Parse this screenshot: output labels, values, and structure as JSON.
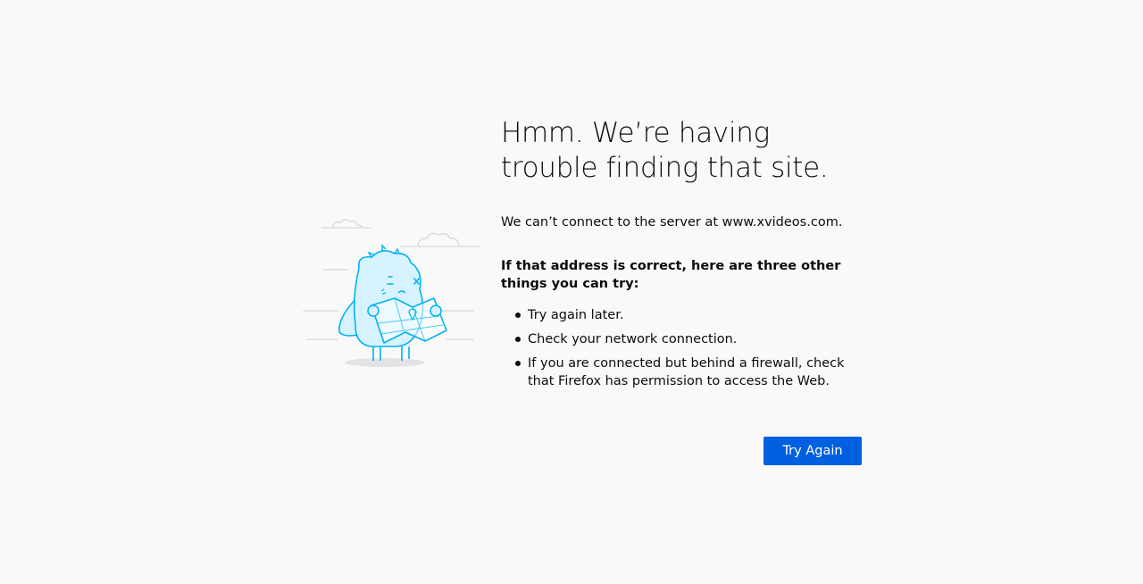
{
  "error_page": {
    "title": "Hmm. We’re having trouble finding that site.",
    "description": "We can’t connect to the server at www.xvideos.com.",
    "advice_heading": "If that address is correct, here are three other things you can try:",
    "tips": [
      "Try again later.",
      "Check your network connection.",
      "If you are connected but behind a firewall, check that Firefox has permission to access the Web."
    ],
    "try_again_label": "Try Again"
  },
  "illustration": {
    "icon": "confused-dinosaur-with-map-icon"
  },
  "colors": {
    "background": "#f9f9fa",
    "text": "#0c0c0d",
    "button": "#0060df",
    "illustration_stroke": "#00b3f4",
    "illustration_fill": "#d7f3ff"
  }
}
